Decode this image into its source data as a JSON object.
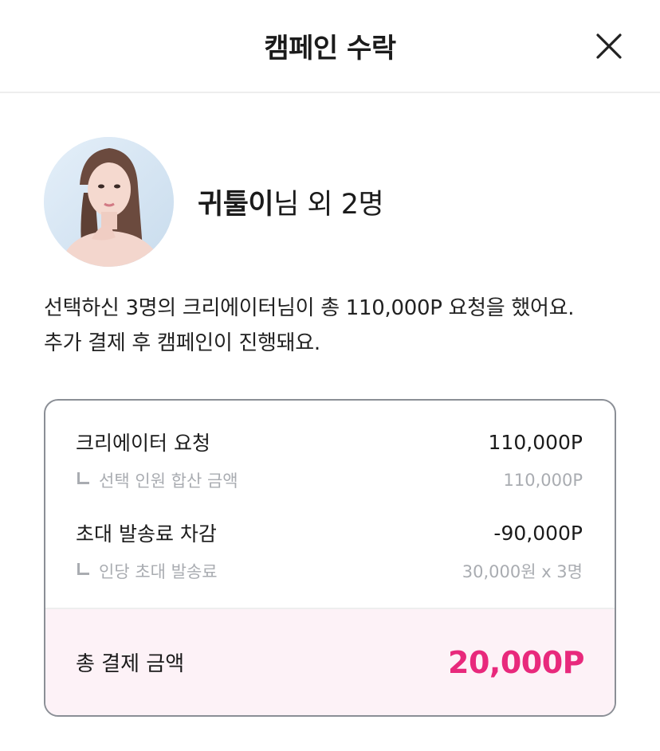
{
  "header": {
    "title": "캠페인 수락",
    "close_icon": "close-icon"
  },
  "profile": {
    "avatar_icon": "creator-avatar",
    "creator_name": "귀툴이",
    "suffix": "님 외 2명"
  },
  "description": {
    "line1": "선택하신 3명의 크리에이터님이 총 110,000P 요청을 했어요.",
    "line2": "추가 결제 후 캠페인이 진행돼요."
  },
  "summary": {
    "creator_request": {
      "label": "크리에이터 요청",
      "value": "110,000P"
    },
    "creator_request_detail": {
      "label": "선택 인원 합산 금액",
      "value": "110,000P"
    },
    "shipping_deduction": {
      "label": "초대 발송료 차감",
      "value": "-90,000P"
    },
    "shipping_detail": {
      "label": "인당 초대 발송료",
      "value": "30,000원 x 3명"
    },
    "total": {
      "label": "총 결제 금액",
      "value": "20,000P"
    }
  },
  "colors": {
    "accent": "#e8297c",
    "total_bg": "#fdf2f7",
    "muted": "#a9acb1"
  }
}
